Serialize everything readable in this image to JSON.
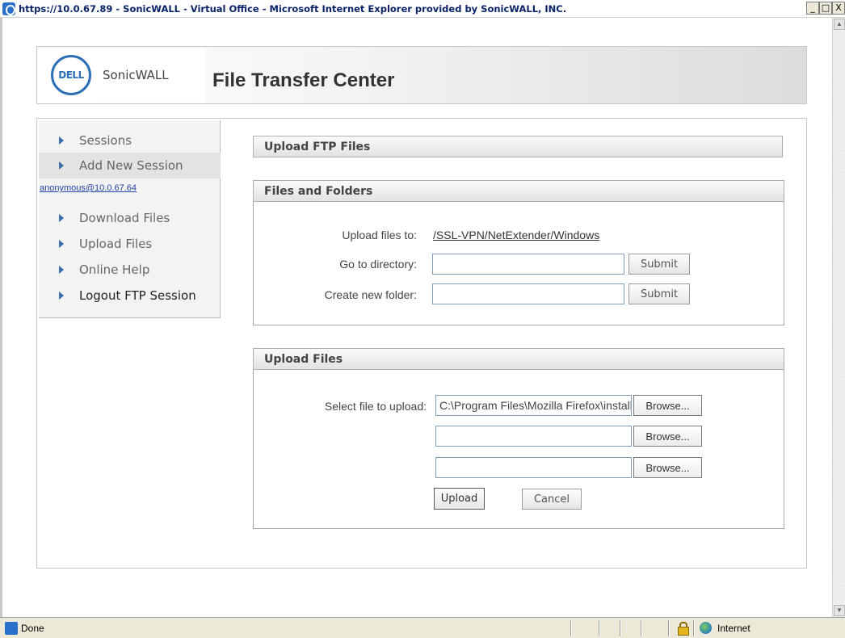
{
  "window": {
    "title": "https://10.0.67.89 - SonicWALL - Virtual Office - Microsoft Internet Explorer provided by SonicWALL, INC.",
    "minimize": "_",
    "maximize": "□",
    "close": "X"
  },
  "header": {
    "dell_logo": "DELL",
    "brand": "SonicWALL",
    "title": "File Transfer Center"
  },
  "sidebar": {
    "items": [
      {
        "label": "Sessions"
      },
      {
        "label": "Add New Session"
      },
      {
        "label": "Download Files"
      },
      {
        "label": "Upload Files"
      },
      {
        "label": "Online Help"
      },
      {
        "label": "Logout FTP Session"
      }
    ],
    "user": "anonymous@10.0.67.64"
  },
  "main": {
    "page_header": "Upload FTP Files",
    "files_folders": {
      "title": "Files and Folders",
      "upload_to_label": "Upload files to:",
      "upload_to_path": "/SSL-VPN/NetExtender/Windows",
      "goto_label": "Go to directory:",
      "goto_value": "",
      "newfolder_label": "Create new folder:",
      "newfolder_value": "",
      "submit_label": "Submit"
    },
    "upload_files": {
      "title": "Upload Files",
      "select_label": "Select file to upload:",
      "file1": "C:\\Program Files\\Mozilla Firefox\\install.log",
      "file2": "",
      "file3": "",
      "browse_label": "Browse...",
      "upload_label": "Upload",
      "cancel_label": "Cancel"
    }
  },
  "statusbar": {
    "status": "Done",
    "zone": "Internet"
  }
}
